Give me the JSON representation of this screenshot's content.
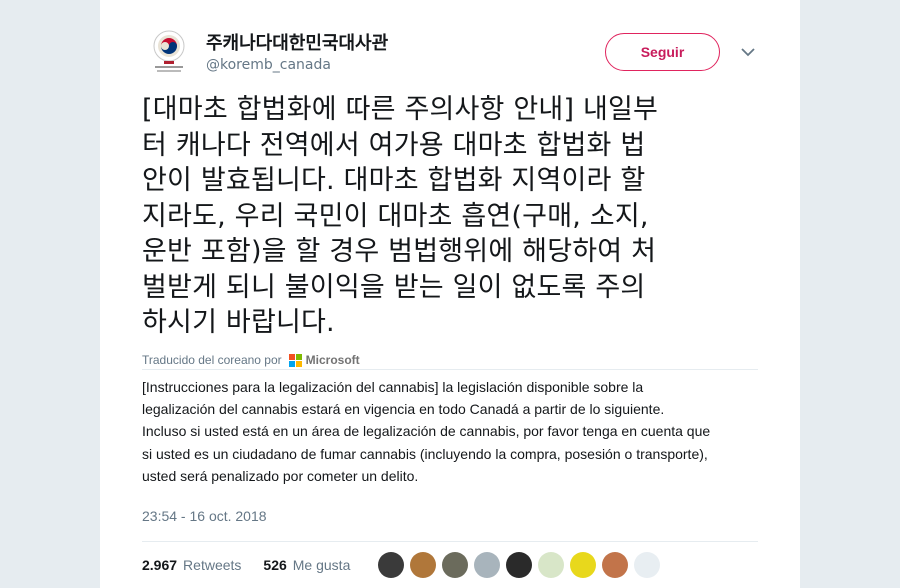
{
  "author": {
    "display_name": "주캐나다대한민국대사관",
    "handle": "@koremb_canada",
    "avatar_icon": "korean-embassy-seal-icon"
  },
  "follow_button": {
    "label": "Seguir"
  },
  "tweet": {
    "lines": [
      "[대마초 합법화에 따른 주의사항 안내] 내일부",
      "터 캐나다 전역에서 여가용 대마초 합법화 법",
      "안이 발효됩니다. 대마초 합법화 지역이라 할",
      "지라도, 우리 국민이 대마초 흡연(구매, 소지,",
      "운반 포함)을 할 경우 범법행위에 해당하여 처",
      "벌받게 되니 불이익을 받는 일이 없도록 주의",
      "하시기 바랍니다."
    ]
  },
  "translation": {
    "by_label": "Traducido del coreano por",
    "provider": "Microsoft",
    "lines": [
      "[Instrucciones para la legalización del cannabis] la legislación disponible sobre la",
      "legalización del cannabis estará en vigencia en todo Canadá a partir de lo siguiente.",
      "Incluso si usted está en un área de legalización de cannabis, por favor tenga en cuenta que",
      "si usted es un ciudadano de fumar cannabis (incluyendo la compra, posesión o transporte),",
      "usted será penalizado por cometer un delito."
    ]
  },
  "timestamp": "23:54 - 16 oct. 2018",
  "stats": {
    "retweets_count": "2.967",
    "retweets_label": "Retweets",
    "likes_count": "526",
    "likes_label": "Me gusta"
  },
  "likers": [
    {
      "color": "#3a3a3a"
    },
    {
      "color": "#b0773a"
    },
    {
      "color": "#6b6b5c"
    },
    {
      "color": "#a8b4bc"
    },
    {
      "color": "#2a2a2a"
    },
    {
      "color": "#d8e6c8"
    },
    {
      "color": "#e8d81c"
    },
    {
      "color": "#c2744a"
    },
    {
      "color": "#e8eef2"
    }
  ],
  "colors": {
    "follow": "#e0245e",
    "text": "#14171a",
    "muted": "#657786"
  }
}
